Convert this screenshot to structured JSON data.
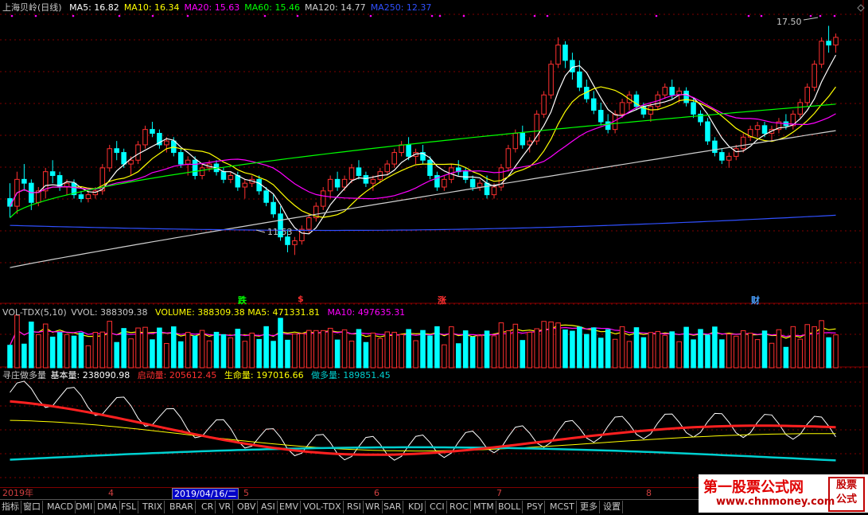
{
  "main_panel": {
    "stock_title": "上海贝岭(日线)",
    "indicators": [
      {
        "label": "MA5: 16.82",
        "color": "#ffffff"
      },
      {
        "label": "MA10: 16.34",
        "color": "#ffff00"
      },
      {
        "label": "MA20: 15.63",
        "color": "#ff00ff"
      },
      {
        "label": "MA60: 15.46",
        "color": "#00ff00"
      },
      {
        "label": "MA120: 14.77",
        "color": "#d0d0d0"
      },
      {
        "label": "MA250: 12.37",
        "color": "#3050ff"
      }
    ],
    "high_label": "17.50",
    "low_label": "11.53",
    "signals": [
      {
        "text": "跌",
        "color": "#00ff00"
      },
      {
        "text": "$",
        "color": "#ff3030"
      },
      {
        "text": "涨",
        "color": "#ff3030"
      },
      {
        "text": "财",
        "color": "#4aa0ff"
      }
    ]
  },
  "volume_panel": {
    "title": "VOL-TDX(5,10)",
    "vvol": "VVOL: 388309.38",
    "volume": "VOLUME: 388309.38",
    "ma5": "MA5: 471331.81",
    "ma10": "MA10: 497635.31"
  },
  "indicator_panel": {
    "title": "寻庄做多量",
    "base": "基本量: 238090.98",
    "start": "启动量: 205612.45",
    "life": "生命量: 197016.66",
    "long": "做多量: 189851.45"
  },
  "axis": {
    "year_label": "2019年",
    "cursor_date": "2019/04/16/二",
    "month_ticks": [
      "4",
      "5",
      "6",
      "7",
      "8"
    ]
  },
  "tabs": [
    "指标",
    "窗口",
    "MACD",
    "DMI",
    "DMA",
    "FSL",
    "TRIX",
    "BRAR",
    "CR",
    "VR",
    "OBV",
    "ASI",
    "EMV",
    "VOL-TDX",
    "RSI",
    "WR",
    "SAR",
    "KDJ",
    "CCI",
    "ROC",
    "MTM",
    "BOLL",
    "PSY",
    "MCST",
    "更多",
    "设置"
  ],
  "watermark": {
    "title": "第一股票公式网",
    "url": "www.chnmoney.com",
    "box_line1": "股票",
    "box_line2": "公式"
  },
  "colors": {
    "up": "#ff3030",
    "down": "#00ffff",
    "ma5": "#ffffff",
    "ma10": "#ffff00",
    "ma20": "#ff00ff",
    "ma60": "#00ff00",
    "ma120": "#d0d0d0",
    "ma250": "#3050ff",
    "grid": "#800000"
  },
  "chart_data": {
    "type": "candlestick",
    "price_range": [
      11.53,
      17.5
    ],
    "daily_bars": [
      [
        13.0,
        13.4,
        12.5,
        12.8
      ],
      [
        12.8,
        13.7,
        12.6,
        13.5
      ],
      [
        13.5,
        13.9,
        13.2,
        13.4
      ],
      [
        13.4,
        13.5,
        12.7,
        12.9
      ],
      [
        12.9,
        13.3,
        12.8,
        13.2
      ],
      [
        13.2,
        13.8,
        13.0,
        13.7
      ],
      [
        13.7,
        14.0,
        13.4,
        13.6
      ],
      [
        13.6,
        13.7,
        13.2,
        13.3
      ],
      [
        13.3,
        13.5,
        13.1,
        13.4
      ],
      [
        13.4,
        13.5,
        13.0,
        13.1
      ],
      [
        13.1,
        13.2,
        12.9,
        13.0
      ],
      [
        13.0,
        13.2,
        12.9,
        13.1
      ],
      [
        13.1,
        13.3,
        13.0,
        13.2
      ],
      [
        13.2,
        13.9,
        13.1,
        13.8
      ],
      [
        13.8,
        14.4,
        13.7,
        14.3
      ],
      [
        14.3,
        14.5,
        14.0,
        14.2
      ],
      [
        14.2,
        14.3,
        13.8,
        13.9
      ],
      [
        13.9,
        14.1,
        13.6,
        14.0
      ],
      [
        14.0,
        14.5,
        13.9,
        14.4
      ],
      [
        14.4,
        14.9,
        14.3,
        14.8
      ],
      [
        14.8,
        15.0,
        14.6,
        14.7
      ],
      [
        14.7,
        14.8,
        14.3,
        14.4
      ],
      [
        14.4,
        14.6,
        14.2,
        14.5
      ],
      [
        14.5,
        14.6,
        14.1,
        14.2
      ],
      [
        14.2,
        14.3,
        13.8,
        13.9
      ],
      [
        13.9,
        14.1,
        13.6,
        14.0
      ],
      [
        14.0,
        14.1,
        13.5,
        13.6
      ],
      [
        13.6,
        13.9,
        13.5,
        13.8
      ],
      [
        13.8,
        14.0,
        13.7,
        13.9
      ],
      [
        13.9,
        14.0,
        13.6,
        13.7
      ],
      [
        13.7,
        13.8,
        13.4,
        13.5
      ],
      [
        13.5,
        13.7,
        13.4,
        13.6
      ],
      [
        13.6,
        13.7,
        13.2,
        13.3
      ],
      [
        13.3,
        13.5,
        13.0,
        13.4
      ],
      [
        13.4,
        13.6,
        13.3,
        13.5
      ],
      [
        13.5,
        13.6,
        13.1,
        13.2
      ],
      [
        13.2,
        13.3,
        12.8,
        12.9
      ],
      [
        12.9,
        13.1,
        12.5,
        12.6
      ],
      [
        12.6,
        12.8,
        11.9,
        12.0
      ],
      [
        12.0,
        12.2,
        11.6,
        11.8
      ],
      [
        11.8,
        12.0,
        11.53,
        11.9
      ],
      [
        11.9,
        12.3,
        11.8,
        12.2
      ],
      [
        12.2,
        12.6,
        12.1,
        12.5
      ],
      [
        12.5,
        12.9,
        12.4,
        12.8
      ],
      [
        12.8,
        13.3,
        12.7,
        13.2
      ],
      [
        13.2,
        13.6,
        13.0,
        13.5
      ],
      [
        13.5,
        13.7,
        13.2,
        13.3
      ],
      [
        13.3,
        13.6,
        13.2,
        13.5
      ],
      [
        13.5,
        13.9,
        13.4,
        13.8
      ],
      [
        13.8,
        14.0,
        13.5,
        13.6
      ],
      [
        13.6,
        13.7,
        13.3,
        13.4
      ],
      [
        13.4,
        13.6,
        13.2,
        13.5
      ],
      [
        13.5,
        13.8,
        13.4,
        13.7
      ],
      [
        13.7,
        14.0,
        13.6,
        13.9
      ],
      [
        13.9,
        14.3,
        13.8,
        14.2
      ],
      [
        14.2,
        14.5,
        14.1,
        14.4
      ],
      [
        14.4,
        14.6,
        14.0,
        14.1
      ],
      [
        14.1,
        14.3,
        13.9,
        14.2
      ],
      [
        14.2,
        14.4,
        13.9,
        14.0
      ],
      [
        14.0,
        14.1,
        13.5,
        13.6
      ],
      [
        13.6,
        13.7,
        13.2,
        13.3
      ],
      [
        13.3,
        13.6,
        13.2,
        13.5
      ],
      [
        13.5,
        13.9,
        13.4,
        13.8
      ],
      [
        13.8,
        14.0,
        13.6,
        13.7
      ],
      [
        13.7,
        13.8,
        13.4,
        13.5
      ],
      [
        13.5,
        13.6,
        13.2,
        13.3
      ],
      [
        13.3,
        13.5,
        13.2,
        13.4
      ],
      [
        13.4,
        13.6,
        13.0,
        13.1
      ],
      [
        13.1,
        13.4,
        13.0,
        13.3
      ],
      [
        13.3,
        13.9,
        13.2,
        13.8
      ],
      [
        13.8,
        14.4,
        13.7,
        14.3
      ],
      [
        14.3,
        14.8,
        14.2,
        14.7
      ],
      [
        14.7,
        14.9,
        14.3,
        14.4
      ],
      [
        14.4,
        14.6,
        14.2,
        14.5
      ],
      [
        14.5,
        15.3,
        14.4,
        15.2
      ],
      [
        15.2,
        15.8,
        15.1,
        15.7
      ],
      [
        15.7,
        16.6,
        15.6,
        16.5
      ],
      [
        16.5,
        17.2,
        16.4,
        17.0
      ],
      [
        17.0,
        17.1,
        16.4,
        16.6
      ],
      [
        16.6,
        16.8,
        16.1,
        16.3
      ],
      [
        16.3,
        16.6,
        15.8,
        15.9
      ],
      [
        15.9,
        16.1,
        15.5,
        15.6
      ],
      [
        15.6,
        15.8,
        15.2,
        15.3
      ],
      [
        15.3,
        15.5,
        14.9,
        15.0
      ],
      [
        15.0,
        15.2,
        14.7,
        14.8
      ],
      [
        14.8,
        15.3,
        14.7,
        15.2
      ],
      [
        15.2,
        15.6,
        15.1,
        15.5
      ],
      [
        15.5,
        15.8,
        15.3,
        15.7
      ],
      [
        15.7,
        15.8,
        15.3,
        15.4
      ],
      [
        15.4,
        15.5,
        15.1,
        15.2
      ],
      [
        15.2,
        15.5,
        15.0,
        15.4
      ],
      [
        15.4,
        15.8,
        15.3,
        15.7
      ],
      [
        15.7,
        16.0,
        15.6,
        15.9
      ],
      [
        15.9,
        16.1,
        15.6,
        15.7
      ],
      [
        15.7,
        15.9,
        15.5,
        15.8
      ],
      [
        15.8,
        15.9,
        15.4,
        15.5
      ],
      [
        15.5,
        15.6,
        15.1,
        15.2
      ],
      [
        15.2,
        15.3,
        14.9,
        15.0
      ],
      [
        15.0,
        15.1,
        14.4,
        14.5
      ],
      [
        14.5,
        14.6,
        14.1,
        14.2
      ],
      [
        14.2,
        14.3,
        13.9,
        14.0
      ],
      [
        14.0,
        14.2,
        13.8,
        14.1
      ],
      [
        14.1,
        14.4,
        14.0,
        14.3
      ],
      [
        14.3,
        14.7,
        14.2,
        14.6
      ],
      [
        14.6,
        14.9,
        14.5,
        14.8
      ],
      [
        14.8,
        15.0,
        14.6,
        14.9
      ],
      [
        14.9,
        15.0,
        14.6,
        14.7
      ],
      [
        14.7,
        14.9,
        14.5,
        14.8
      ],
      [
        14.8,
        15.1,
        14.7,
        15.0
      ],
      [
        15.0,
        15.2,
        14.8,
        14.9
      ],
      [
        14.9,
        15.3,
        14.8,
        15.2
      ],
      [
        15.2,
        15.6,
        15.1,
        15.5
      ],
      [
        15.5,
        16.0,
        15.4,
        15.9
      ],
      [
        15.9,
        16.6,
        15.8,
        16.5
      ],
      [
        16.5,
        17.2,
        16.4,
        17.1
      ],
      [
        17.1,
        17.5,
        16.8,
        17.0
      ],
      [
        17.0,
        17.3,
        16.8,
        17.2
      ]
    ],
    "signal_days": [
      40,
      52,
      73,
      115
    ]
  }
}
